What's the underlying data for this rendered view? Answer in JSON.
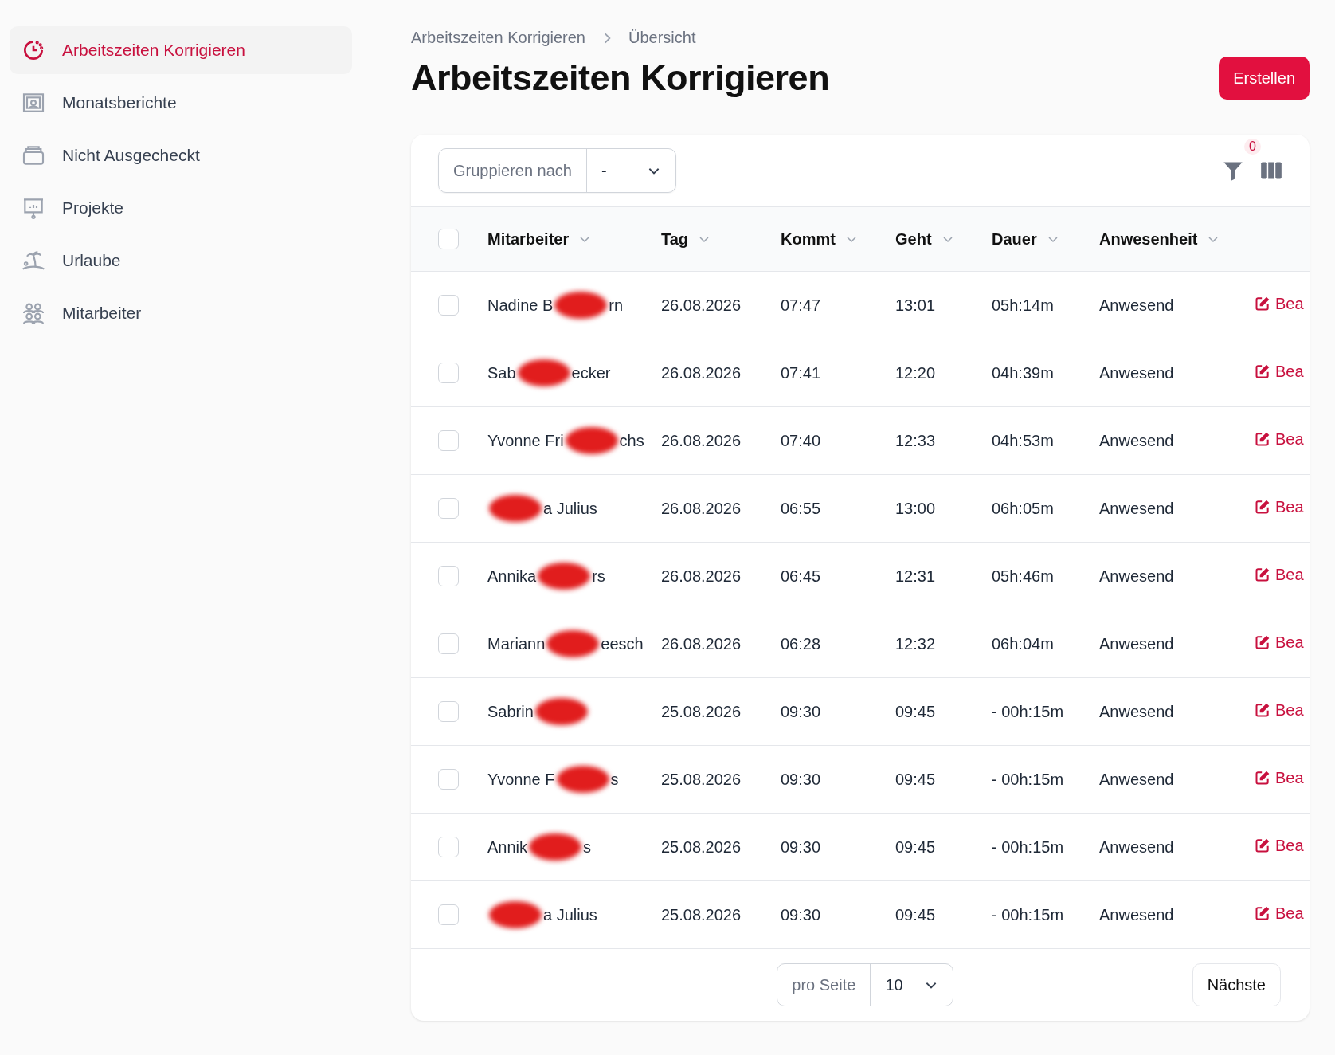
{
  "sidebar": {
    "items": [
      {
        "label": "Arbeitszeiten Korrigieren",
        "selected": true
      },
      {
        "label": "Monatsberichte",
        "selected": false
      },
      {
        "label": "Nicht Ausgecheckt",
        "selected": false
      },
      {
        "label": "Projekte",
        "selected": false
      },
      {
        "label": "Urlaube",
        "selected": false
      },
      {
        "label": "Mitarbeiter",
        "selected": false
      }
    ]
  },
  "breadcrumb": [
    "Arbeitszeiten Korrigieren",
    "Übersicht"
  ],
  "title": "Arbeitszeiten Korrigieren",
  "create_button": "Erstellen",
  "toolbar": {
    "group_label": "Gruppieren nach",
    "group_value": "-",
    "filter_count": "0"
  },
  "table": {
    "select_all": {
      "checked": false
    },
    "columns": [
      "Mitarbeiter",
      "Tag",
      "Kommt",
      "Geht",
      "Dauer",
      "Anwesenheit"
    ],
    "rows": [
      {
        "selected": false,
        "name_before": "Nadine B",
        "name_after": "rn",
        "day": "26.08.2026",
        "in": "07:47",
        "out": "13:01",
        "duration": "05h:14m",
        "status": "Anwesend",
        "action": "Bea"
      },
      {
        "selected": false,
        "name_before": "Sab",
        "name_after": "ecker",
        "day": "26.08.2026",
        "in": "07:41",
        "out": "12:20",
        "duration": "04h:39m",
        "status": "Anwesend",
        "action": "Bea"
      },
      {
        "selected": false,
        "name_before": "Yvonne Fri",
        "name_after": "chs",
        "day": "26.08.2026",
        "in": "07:40",
        "out": "12:33",
        "duration": "04h:53m",
        "status": "Anwesend",
        "action": "Bea"
      },
      {
        "selected": false,
        "name_before": "",
        "name_after": "a Julius",
        "day": "26.08.2026",
        "in": "06:55",
        "out": "13:00",
        "duration": "06h:05m",
        "status": "Anwesend",
        "action": "Bea"
      },
      {
        "selected": false,
        "name_before": "Annika",
        "name_after": "rs",
        "day": "26.08.2026",
        "in": "06:45",
        "out": "12:31",
        "duration": "05h:46m",
        "status": "Anwesend",
        "action": "Bea"
      },
      {
        "selected": false,
        "name_before": "Mariann",
        "name_after": "eesch",
        "day": "26.08.2026",
        "in": "06:28",
        "out": "12:32",
        "duration": "06h:04m",
        "status": "Anwesend",
        "action": "Bea"
      },
      {
        "selected": false,
        "name_before": "Sabrin",
        "name_after": "",
        "day": "25.08.2026",
        "in": "09:30",
        "out": "09:45",
        "duration": "- 00h:15m",
        "status": "Anwesend",
        "action": "Bea"
      },
      {
        "selected": false,
        "name_before": "Yvonne F",
        "name_after": "s",
        "day": "25.08.2026",
        "in": "09:30",
        "out": "09:45",
        "duration": "- 00h:15m",
        "status": "Anwesend",
        "action": "Bea"
      },
      {
        "selected": false,
        "name_before": "Annik",
        "name_after": "s",
        "day": "25.08.2026",
        "in": "09:30",
        "out": "09:45",
        "duration": "- 00h:15m",
        "status": "Anwesend",
        "action": "Bea"
      },
      {
        "selected": false,
        "name_before": "",
        "name_after": "a Julius",
        "day": "25.08.2026",
        "in": "09:30",
        "out": "09:45",
        "duration": "- 00h:15m",
        "status": "Anwesend",
        "action": "Bea"
      }
    ]
  },
  "pagination": {
    "per_page_label": "pro Seite",
    "per_page_value": "10",
    "next": "Nächste"
  }
}
